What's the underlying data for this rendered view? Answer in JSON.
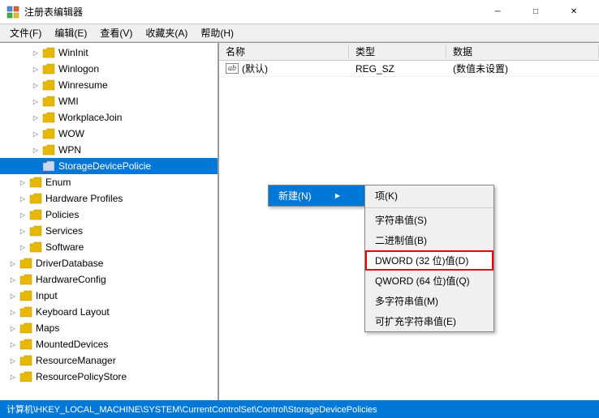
{
  "window": {
    "title": "注册表编辑器",
    "icon": "regedit-icon"
  },
  "titlebar": {
    "minimize_label": "─",
    "maximize_label": "□",
    "close_label": "✕"
  },
  "menubar": {
    "items": [
      {
        "label": "文件(F)",
        "id": "menu-file"
      },
      {
        "label": "编辑(E)",
        "id": "menu-edit"
      },
      {
        "label": "查看(V)",
        "id": "menu-view"
      },
      {
        "label": "收藏夹(A)",
        "id": "menu-favorites"
      },
      {
        "label": "帮助(H)",
        "id": "menu-help"
      }
    ]
  },
  "tree": {
    "items": [
      {
        "label": "WinInit",
        "indent": 2,
        "has_arrow": true,
        "arrow": "▷",
        "selected": false
      },
      {
        "label": "Winlogon",
        "indent": 2,
        "has_arrow": true,
        "arrow": "▷",
        "selected": false
      },
      {
        "label": "Winresume",
        "indent": 2,
        "has_arrow": true,
        "arrow": "▷",
        "selected": false
      },
      {
        "label": "WMI",
        "indent": 2,
        "has_arrow": true,
        "arrow": "▷",
        "selected": false
      },
      {
        "label": "WorkplaceJoin",
        "indent": 2,
        "has_arrow": true,
        "arrow": "▷",
        "selected": false
      },
      {
        "label": "WOW",
        "indent": 2,
        "has_arrow": true,
        "arrow": "▷",
        "selected": false
      },
      {
        "label": "WPN",
        "indent": 2,
        "has_arrow": true,
        "arrow": "▷",
        "selected": false
      },
      {
        "label": "StorageDevicePolicie",
        "indent": 2,
        "has_arrow": false,
        "arrow": "",
        "selected": true
      },
      {
        "label": "Enum",
        "indent": 1,
        "has_arrow": true,
        "arrow": "▷",
        "selected": false
      },
      {
        "label": "Hardware Profiles",
        "indent": 1,
        "has_arrow": true,
        "arrow": "▷",
        "selected": false
      },
      {
        "label": "Policies",
        "indent": 1,
        "has_arrow": true,
        "arrow": "▷",
        "selected": false
      },
      {
        "label": "Services",
        "indent": 1,
        "has_arrow": true,
        "arrow": "▷",
        "selected": false
      },
      {
        "label": "Software",
        "indent": 1,
        "has_arrow": true,
        "arrow": "▷",
        "selected": false
      },
      {
        "label": "DriverDatabase",
        "indent": 0,
        "has_arrow": true,
        "arrow": "▷",
        "selected": false
      },
      {
        "label": "HardwareConfig",
        "indent": 0,
        "has_arrow": true,
        "arrow": "▷",
        "selected": false
      },
      {
        "label": "Input",
        "indent": 0,
        "has_arrow": true,
        "arrow": "▷",
        "selected": false
      },
      {
        "label": "Keyboard Layout",
        "indent": 0,
        "has_arrow": true,
        "arrow": "▷",
        "selected": false
      },
      {
        "label": "Maps",
        "indent": 0,
        "has_arrow": true,
        "arrow": "▷",
        "selected": false
      },
      {
        "label": "MountedDevices",
        "indent": 0,
        "has_arrow": true,
        "arrow": "▷",
        "selected": false
      },
      {
        "label": "ResourceManager",
        "indent": 0,
        "has_arrow": true,
        "arrow": "▷",
        "selected": false
      },
      {
        "label": "ResourcePolicyStore",
        "indent": 0,
        "has_arrow": true,
        "arrow": "▷",
        "selected": false
      }
    ]
  },
  "table": {
    "columns": [
      "名称",
      "类型",
      "数据"
    ],
    "rows": [
      {
        "name": "(默认)",
        "type": "REG_SZ",
        "data": "(数值未设置)",
        "icon": "ab"
      }
    ]
  },
  "context_menu": {
    "main_item": "新建(N)",
    "submenu_items": [
      {
        "label": "项(K)",
        "highlighted": false
      },
      {
        "label": "字符串值(S)",
        "highlighted": false
      },
      {
        "label": "二进制值(B)",
        "highlighted": false
      },
      {
        "label": "DWORD (32 位)值(D)",
        "highlighted": true,
        "red_border": true
      },
      {
        "label": "QWORD (64 位)值(Q)",
        "highlighted": false
      },
      {
        "label": "多字符串值(M)",
        "highlighted": false
      },
      {
        "label": "可扩充字符串值(E)",
        "highlighted": false
      }
    ]
  },
  "status_bar": {
    "text": "计算机\\HKEY_LOCAL_MACHINE\\SYSTEM\\CurrentControlSet\\Control\\StorageDevicePolicies"
  }
}
